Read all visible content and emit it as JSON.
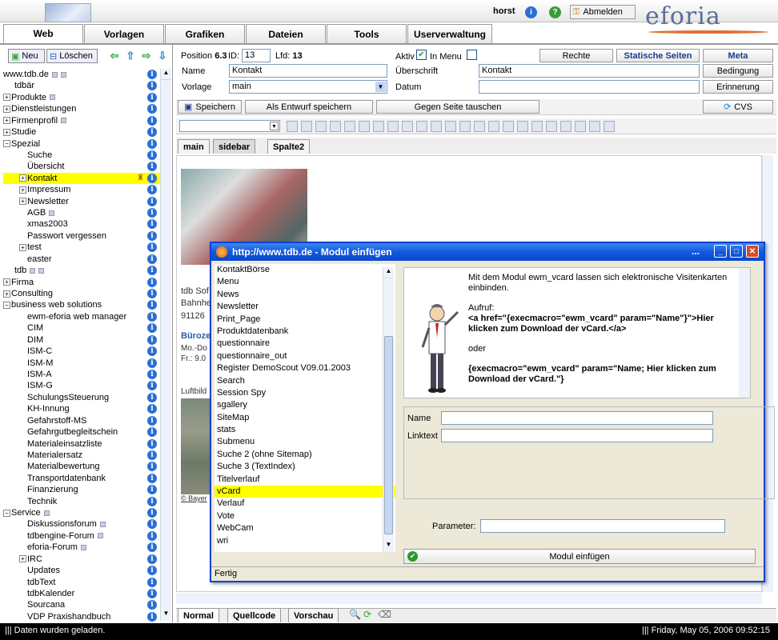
{
  "header": {
    "user": "horst",
    "logout_label": "Abmelden",
    "brand": "eforia"
  },
  "tabs": [
    "Web",
    "Vorlagen",
    "Grafiken",
    "Dateien",
    "Tools",
    "Userverwaltung"
  ],
  "left_toolbar": {
    "new_label": "Neu",
    "delete_label": "Löschen"
  },
  "tree": [
    {
      "label": "www.tdb.de",
      "indent": 0,
      "pm": "",
      "mini": 2
    },
    {
      "label": "tdbär",
      "indent": 1,
      "pm": "",
      "mini": 0
    },
    {
      "label": "Produkte",
      "indent": 0,
      "pm": "+",
      "mini": 1
    },
    {
      "label": "Dienstleistungen",
      "indent": 0,
      "pm": "+",
      "mini": 0
    },
    {
      "label": "Firmenprofil",
      "indent": 0,
      "pm": "+",
      "mini": 1
    },
    {
      "label": "Studie",
      "indent": 0,
      "pm": "+",
      "mini": 0
    },
    {
      "label": "Spezial",
      "indent": 0,
      "pm": "-",
      "mini": 0
    },
    {
      "label": "Suche",
      "indent": 2,
      "pm": "",
      "mini": 0
    },
    {
      "label": "Übersicht",
      "indent": 2,
      "pm": "",
      "mini": 0
    },
    {
      "label": "Kontakt",
      "indent": 1,
      "pm": "+",
      "mini": 0,
      "selected": true
    },
    {
      "label": "Impressum",
      "indent": 1,
      "pm": "+",
      "mini": 0
    },
    {
      "label": "Newsletter",
      "indent": 1,
      "pm": "+",
      "mini": 0
    },
    {
      "label": "AGB",
      "indent": 2,
      "pm": "",
      "mini": 1
    },
    {
      "label": "xmas2003",
      "indent": 2,
      "pm": "",
      "mini": 0
    },
    {
      "label": "Passwort vergessen",
      "indent": 2,
      "pm": "",
      "mini": 0
    },
    {
      "label": "test",
      "indent": 1,
      "pm": "+",
      "mini": 0
    },
    {
      "label": "easter",
      "indent": 2,
      "pm": "",
      "mini": 0
    },
    {
      "label": "tdb",
      "indent": 1,
      "pm": "",
      "mini": 2
    },
    {
      "label": "Firma",
      "indent": 0,
      "pm": "+",
      "mini": 0
    },
    {
      "label": "Consulting",
      "indent": 0,
      "pm": "+",
      "mini": 0
    },
    {
      "label": "business web solutions",
      "indent": 0,
      "pm": "-",
      "mini": 0
    },
    {
      "label": "ewm-eforia web manager",
      "indent": 2,
      "pm": "",
      "mini": 0
    },
    {
      "label": "CIM",
      "indent": 2,
      "pm": "",
      "mini": 0
    },
    {
      "label": "DIM",
      "indent": 2,
      "pm": "",
      "mini": 0
    },
    {
      "label": "ISM-C",
      "indent": 2,
      "pm": "",
      "mini": 0
    },
    {
      "label": "ISM-M",
      "indent": 2,
      "pm": "",
      "mini": 0
    },
    {
      "label": "ISM-A",
      "indent": 2,
      "pm": "",
      "mini": 0
    },
    {
      "label": "ISM-G",
      "indent": 2,
      "pm": "",
      "mini": 0
    },
    {
      "label": "SchulungsSteuerung",
      "indent": 2,
      "pm": "",
      "mini": 0
    },
    {
      "label": "KH-Innung",
      "indent": 2,
      "pm": "",
      "mini": 0
    },
    {
      "label": "Gefahrstoff-MS",
      "indent": 2,
      "pm": "",
      "mini": 0
    },
    {
      "label": "Gefahrgutbegleitschein",
      "indent": 2,
      "pm": "",
      "mini": 0
    },
    {
      "label": "Materialeinsatzliste",
      "indent": 2,
      "pm": "",
      "mini": 0
    },
    {
      "label": "Materialersatz",
      "indent": 2,
      "pm": "",
      "mini": 0
    },
    {
      "label": "Materialbewertung",
      "indent": 2,
      "pm": "",
      "mini": 0
    },
    {
      "label": "Transportdatenbank",
      "indent": 2,
      "pm": "",
      "mini": 0
    },
    {
      "label": "Finanzierung",
      "indent": 2,
      "pm": "",
      "mini": 0
    },
    {
      "label": "Technik",
      "indent": 2,
      "pm": "",
      "mini": 0
    },
    {
      "label": "Service",
      "indent": 0,
      "pm": "-",
      "mini": 1
    },
    {
      "label": "Diskussionsforum",
      "indent": 2,
      "pm": "",
      "mini": 1
    },
    {
      "label": "tdbengine-Forum",
      "indent": 2,
      "pm": "",
      "mini": 1
    },
    {
      "label": "eforia-Forum",
      "indent": 2,
      "pm": "",
      "mini": 1
    },
    {
      "label": "IRC",
      "indent": 1,
      "pm": "+",
      "mini": 0
    },
    {
      "label": "Updates",
      "indent": 2,
      "pm": "",
      "mini": 0
    },
    {
      "label": "tdbText",
      "indent": 2,
      "pm": "",
      "mini": 0
    },
    {
      "label": "tdbKalender",
      "indent": 2,
      "pm": "",
      "mini": 0
    },
    {
      "label": "Sourcana",
      "indent": 2,
      "pm": "",
      "mini": 0
    },
    {
      "label": "VDP Praxishandbuch",
      "indent": 2,
      "pm": "",
      "mini": 0
    }
  ],
  "form": {
    "position_label": "Position",
    "position_value": "6.3",
    "id_label": "ID:",
    "id_value": "13",
    "lfd_label": "Lfd:",
    "lfd_value": "13",
    "aktiv_label": "Aktiv",
    "inmenu_label": "In Menu",
    "rechte_label": "Rechte",
    "statische_label": "Statische Seiten",
    "meta_label": "Meta",
    "name_label": "Name",
    "name_value": "Kontakt",
    "ueberschrift_label": "Überschrift",
    "ueberschrift_value": "Kontakt",
    "bedingung_label": "Bedingung",
    "vorlage_label": "Vorlage",
    "vorlage_value": "main",
    "datum_label": "Datum",
    "datum_value": "",
    "erinnerung_label": "Erinnerung"
  },
  "actions": {
    "save_label": "Speichern",
    "draft_label": "Als Entwurf speichern",
    "swap_label": "Gegen Seite tauschen",
    "cvs_label": "CVS"
  },
  "subtabs": [
    "main",
    "sidebar",
    "Spalte2"
  ],
  "editor": {
    "line1": "tdb Sof",
    "line2": "Bahnhe",
    "line3": "91126",
    "line4": "Büroze",
    "line5": "Mo.-Do",
    "line6": "Fr.: 9.0",
    "line7": "Luftbild",
    "line8": "© Bayer"
  },
  "bottomtabs": [
    "Normal",
    "Quellcode",
    "Vorschau"
  ],
  "status": {
    "left": "Daten wurden geladen.",
    "right": "Friday, May 05, 2006 09:52:15"
  },
  "dialog": {
    "title": "http://www.tdb.de - Modul einfügen",
    "modules": [
      "KontaktBörse",
      "Menu",
      "News",
      "Newsletter",
      "Print_Page",
      "Produktdatenbank",
      "questionnaire",
      "questionnaire_out",
      "Register DemoScout V09.01.2003",
      "Search",
      "Session Spy",
      "sgallery",
      "SiteMap",
      "stats",
      "Submenu",
      "Suche 2 (ohne Sitemap)",
      "Suche 3 (TextIndex)",
      "Titelverlauf",
      "vCard",
      "Verlauf",
      "Vote",
      "WebCam",
      "wri"
    ],
    "selected_module": "vCard",
    "desc_intro": "Mit dem Modul ewm_vcard lassen sich elektronische Visitenkarten einbinden.",
    "desc_call_label": "Aufruf:",
    "desc_call": "<a href=\"{execmacro=\"ewm_vcard\" param=\"Name\"}\">Hier klicken zum Download der vCard.</a>",
    "desc_or": "oder",
    "desc_alt": "{execmacro=\"ewm_vcard\" param=\"Name; Hier klicken zum Download der vCard.\"}",
    "name_label": "Name",
    "linktext_label": "Linktext",
    "parameter_label": "Parameter:",
    "insert_label": "Modul einfügen",
    "status": "Fertig"
  },
  "colors": {
    "selection": "#ffff00",
    "title_blue": "#0a47cc",
    "info_blue": "#2a6fd4"
  }
}
